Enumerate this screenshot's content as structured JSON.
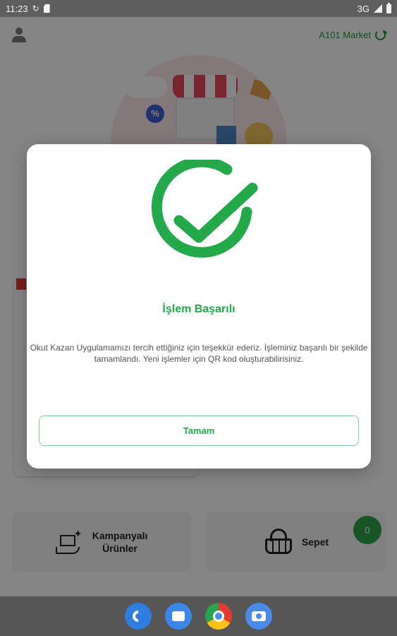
{
  "status_bar": {
    "time": "11:23",
    "network": "3G"
  },
  "header": {
    "market_label": "A101 Market"
  },
  "tiles": {
    "campaign_line1": "Kampanyalı",
    "campaign_line2": "Ürünler",
    "cart_label": "Sepet",
    "cart_count": "0"
  },
  "dialog": {
    "title": "İşlem Başarılı",
    "message": "Okut Kazan Uygulamamızı tercih ettiğiniz için teşekkür ederiz. İşleminiz başarılı bir şekilde tamamlandı. Yeni işlemler için QR kod oluşturabilirisiniz.",
    "button_label": "Tamam"
  },
  "hero": {
    "percent_badge": "%"
  },
  "colors": {
    "success": "#23a84a",
    "brand_green": "#1c9a3e",
    "scrim": "rgba(0,0,0,0.48)"
  },
  "icons": [
    "avatar-icon",
    "refresh-icon",
    "success-check-icon",
    "campaign-icon",
    "basket-icon",
    "phone-icon",
    "messages-icon",
    "chrome-icon",
    "camera-icon"
  ]
}
